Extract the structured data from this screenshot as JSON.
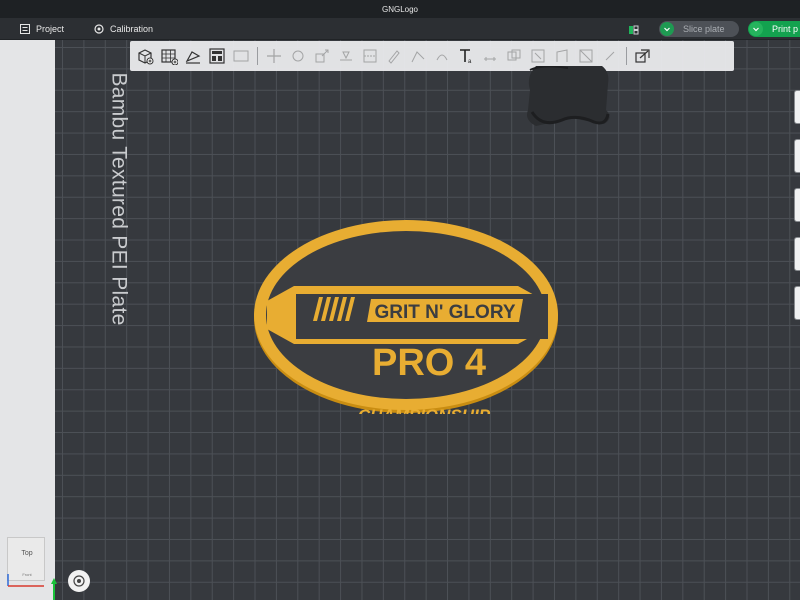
{
  "window": {
    "title": "GNGLogo"
  },
  "menu": {
    "project": "Project",
    "calibration": "Calibration"
  },
  "actions": {
    "slice": "Slice plate",
    "print": "Print p"
  },
  "plate": {
    "label": "Bambu Textured PEI Plate"
  },
  "badge": {
    "brand": "GRIT N' GLORY",
    "title": "PRO 4",
    "subtitle": "CHAMPIONSHIP",
    "colors": {
      "gold": "#e8ad32",
      "dark": "#3b3d41",
      "edge": "#c98d12"
    }
  },
  "navcube": {
    "top": "Top",
    "front": "Front"
  },
  "colors": {
    "grid_bg": "#36393e",
    "grid_line": "#4c5056",
    "accent_green": "#13a24f"
  },
  "toolbar": {
    "icons": [
      "add-object-icon",
      "add-plate-icon",
      "auto-orient-icon",
      "arrange-icon",
      "split-icon",
      "move-icon",
      "rotate-icon",
      "scale-icon",
      "flatten-icon",
      "cut-icon",
      "support-paint-icon",
      "seam-paint-icon",
      "color-paint-icon",
      "text-icon",
      "measure-icon",
      "boolean-icon",
      "assembly-icon",
      "variable-height-icon",
      "mesh-icon",
      "emboss-icon",
      "view-options-icon"
    ]
  }
}
